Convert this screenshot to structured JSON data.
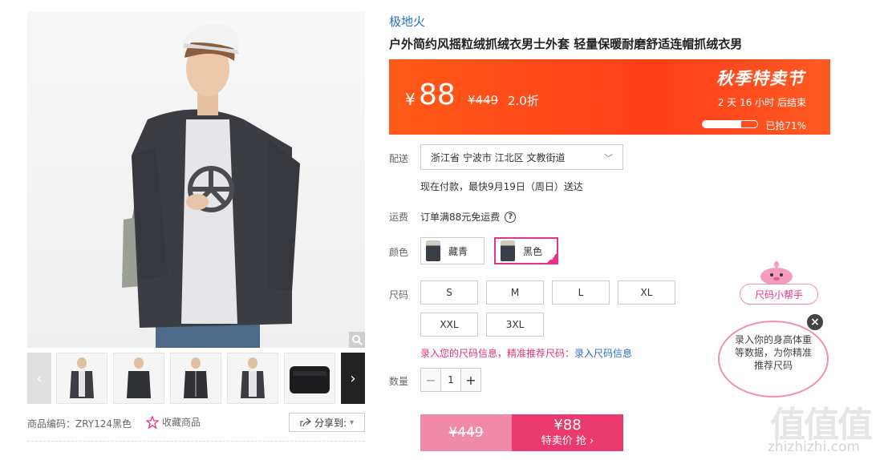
{
  "gallery": {
    "zoom_icon": "magnifier-icon",
    "prev_icon": "chevron-left-icon",
    "next_icon": "chevron-right-icon",
    "thumbnails": [
      "jacket-front-open",
      "jacket-front-zipped",
      "jacket-zipped-hands-pockets",
      "jacket-open-side",
      "jacket-folded-black"
    ]
  },
  "meta": {
    "sku_label": "商品编码：ZRY124黑色",
    "favorite_label": "收藏商品",
    "share_label": "分享到:"
  },
  "product": {
    "brand": "极地火",
    "title": "户外简约风摇粒绒抓绒衣男士外套 轻量保暖耐磨舒适连帽抓绒衣男"
  },
  "price_banner": {
    "currency": "¥",
    "price": "88",
    "original_price": "¥449",
    "discount": "2.0折",
    "badge": "秋季特卖节",
    "countdown": "2  天 16 小时 后结束",
    "sold_label": "已抢71%",
    "sold_fraction": 0.71,
    "bg_color": "#ff4a1c"
  },
  "delivery": {
    "label": "配送",
    "address": "浙江省 宁波市 江北区 文教街道",
    "note": "现在付款，最快9月19日（周日）送达"
  },
  "freight": {
    "label": "运费",
    "text": "订单满88元免运费",
    "help_glyph": "?"
  },
  "colors": {
    "label": "颜色",
    "options": [
      "藏青",
      "黑色"
    ],
    "selected": "黑色",
    "accent": "#e8318a"
  },
  "sizes": {
    "label": "尺码",
    "options": [
      "S",
      "M",
      "L",
      "XL",
      "XXL",
      "3XL"
    ],
    "hint": "录入您的尺码信息，精准推荐尺码：",
    "hint_link": "录入尺码信息"
  },
  "quantity": {
    "label": "数量",
    "value": "1",
    "minus": "−",
    "plus": "+"
  },
  "buy": {
    "original_price": "¥449",
    "price": "¥88",
    "label": "特卖价 抢 ›",
    "color": "#ea3a6e"
  },
  "size_helper": {
    "tag": "尺码小帮手",
    "bubble": "录入你的身高体重等数据，为你精准推荐尺码",
    "close": "×"
  },
  "watermark": {
    "logo": "值值值",
    "url": "zhizhizhi.com"
  }
}
